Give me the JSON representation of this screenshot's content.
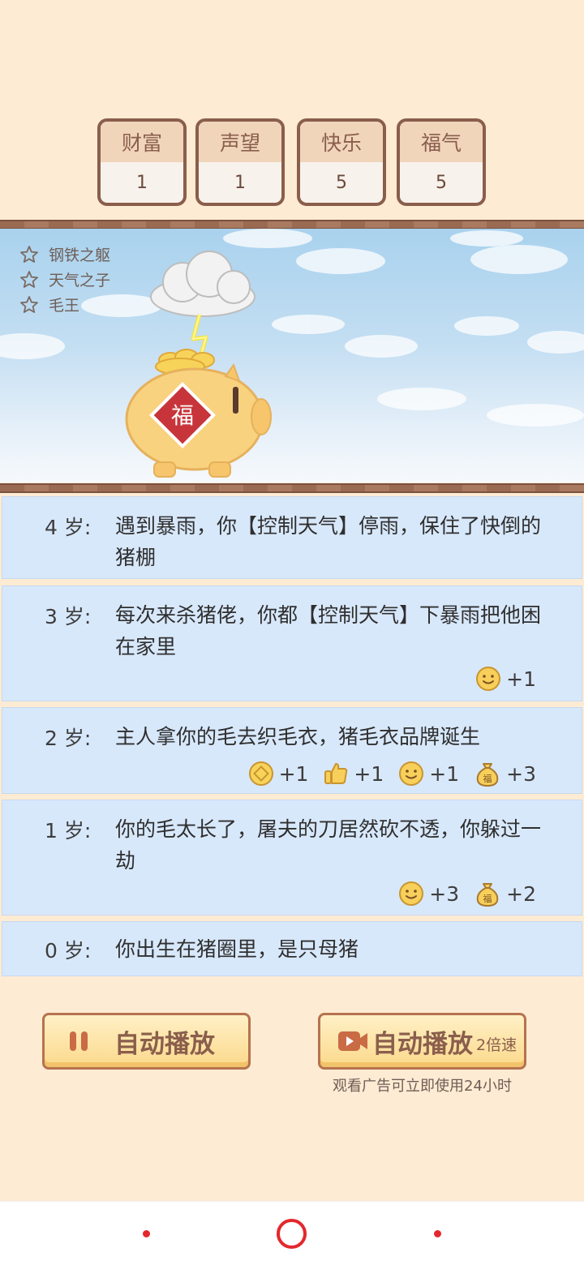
{
  "stats": [
    {
      "label": "财富",
      "value": "1"
    },
    {
      "label": "声望",
      "value": "1"
    },
    {
      "label": "快乐",
      "value": "5"
    },
    {
      "label": "福气",
      "value": "5"
    }
  ],
  "achievements": [
    "钢铁之躯",
    "天气之子",
    "毛王"
  ],
  "events": [
    {
      "age": "4 岁:",
      "text": "遇到暴雨，你【控制天气】停雨，保住了快倒的猪棚",
      "rewards": []
    },
    {
      "age": "3 岁:",
      "text": "每次来杀猪佬，你都【控制天气】下暴雨把他困在家里",
      "rewards": [
        {
          "icon": "smile-icon",
          "value": "+1"
        }
      ]
    },
    {
      "age": "2 岁:",
      "text": "主人拿你的毛去织毛衣，猪毛衣品牌诞生",
      "rewards": [
        {
          "icon": "coin-icon",
          "value": "+1"
        },
        {
          "icon": "thumbs-up-icon",
          "value": "+1"
        },
        {
          "icon": "smile-icon",
          "value": "+1"
        },
        {
          "icon": "lucky-bag-icon",
          "value": "+3"
        }
      ]
    },
    {
      "age": "1 岁:",
      "text": "你的毛太长了，屠夫的刀居然砍不透，你躲过一劫",
      "rewards": [
        {
          "icon": "smile-icon",
          "value": "+3"
        },
        {
          "icon": "lucky-bag-icon",
          "value": "+2"
        }
      ]
    },
    {
      "age": "0 岁:",
      "text": "你出生在猪圈里，是只母猪",
      "rewards": []
    }
  ],
  "buttons": {
    "auto_play": "自动播放",
    "auto_play_ad": "自动播放",
    "speed": "2倍速",
    "ad_hint": "观看广告可立即使用24小时"
  },
  "pig_badge": "福",
  "lucky_glyph": "福",
  "colors": {
    "background": "#fdebd3",
    "accent": "#8a5e4c",
    "event_bg": "#d8e8fb",
    "nav_red": "#e4282d"
  }
}
